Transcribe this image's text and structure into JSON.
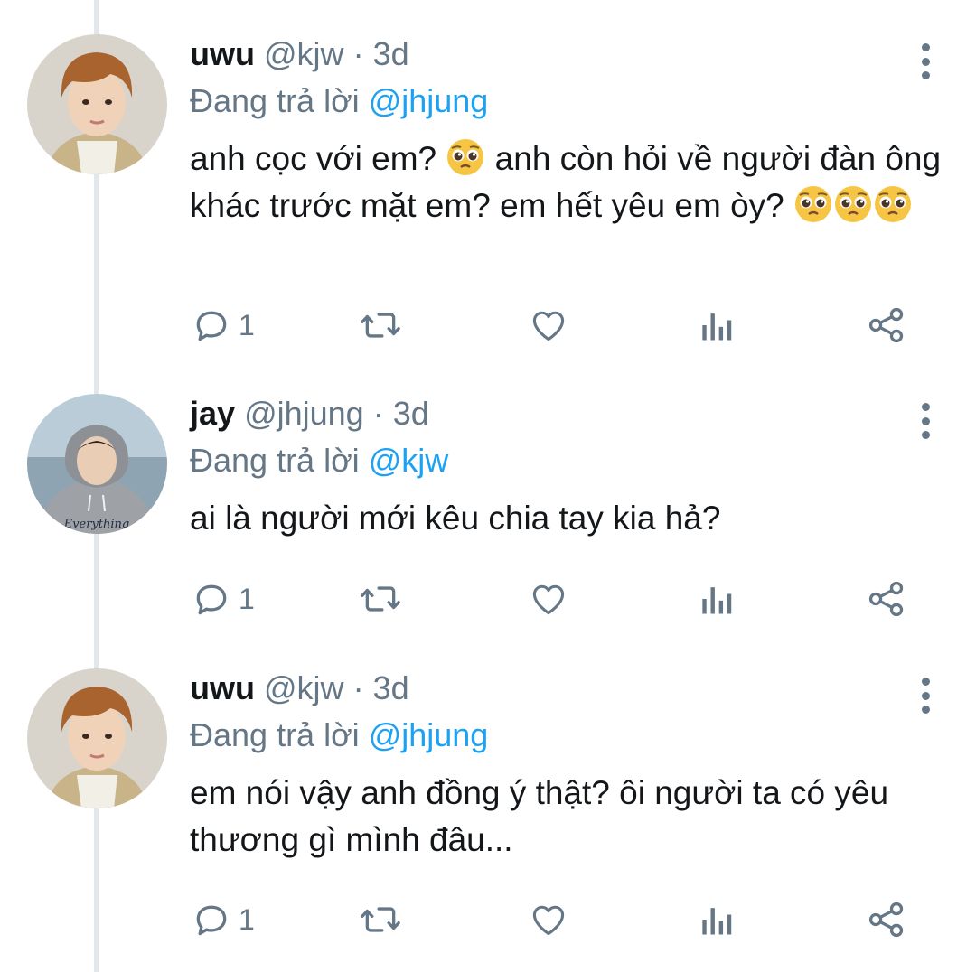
{
  "colors": {
    "accent": "#1da1f2",
    "muted": "#657786",
    "text": "#14171a",
    "thread_line": "#e1e8ed"
  },
  "tweets": [
    {
      "name": "uwu",
      "handle": "@kjw",
      "separator": "·",
      "time": "3d",
      "reply_prefix": "Đang trả lời",
      "reply_mention": "@jhjung",
      "text_parts": [
        "anh cọc với em? ",
        " anh còn hỏi về người đàn ông khác trước mặt em? em hết yêu em òy? "
      ],
      "emoji": "pleading-face-emoji",
      "reply_count": "1"
    },
    {
      "name": "jay",
      "handle": "@jhjung",
      "separator": "·",
      "time": "3d",
      "reply_prefix": "Đang trả lời",
      "reply_mention": "@kjw",
      "text": "ai là người mới kêu chia tay kia hả?",
      "avatar_print": "Everything",
      "reply_count": "1"
    },
    {
      "name": "uwu",
      "handle": "@kjw",
      "separator": "·",
      "time": "3d",
      "reply_prefix": "Đang trả lời",
      "reply_mention": "@jhjung",
      "text": "em nói vậy anh đồng ý thật? ôi người ta có yêu thương gì mình đâu...",
      "reply_count": "1"
    }
  ],
  "icons": {
    "reply": "reply-icon",
    "retweet": "retweet-icon",
    "like": "heart-icon",
    "analytics": "analytics-icon",
    "share": "share-icon",
    "more": "more-vertical-icon"
  }
}
